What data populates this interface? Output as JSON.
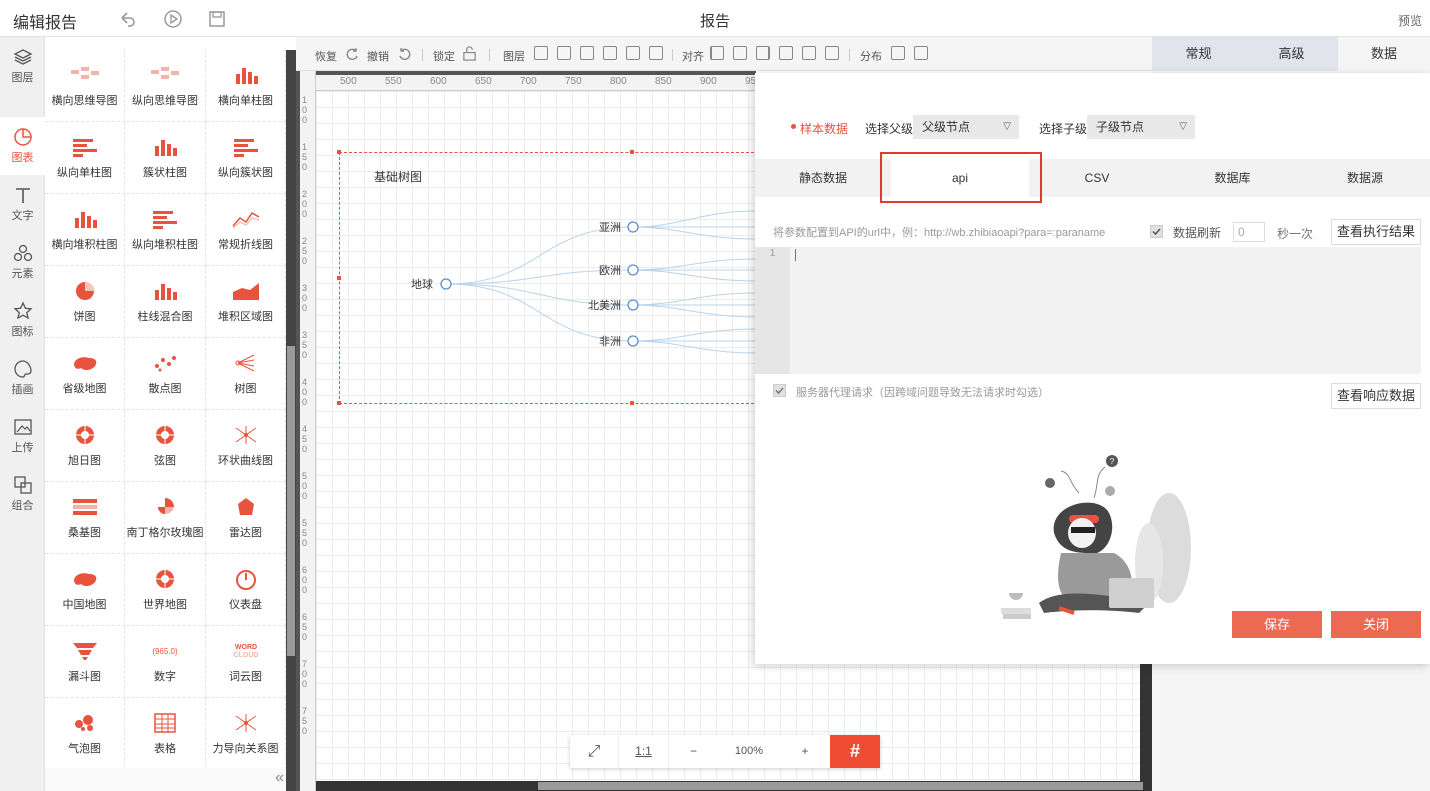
{
  "topbar": {
    "title": "编辑报告",
    "center_title": "报告",
    "preview": "预览"
  },
  "leftnav": [
    {
      "label": "图层",
      "icon": "layers-icon"
    },
    {
      "label": "图表",
      "icon": "chart-icon"
    },
    {
      "label": "文字",
      "icon": "text-icon"
    },
    {
      "label": "元素",
      "icon": "elements-icon"
    },
    {
      "label": "图标",
      "icon": "star-icon"
    },
    {
      "label": "插画",
      "icon": "palette-icon"
    },
    {
      "label": "上传",
      "icon": "upload-icon"
    },
    {
      "label": "组合",
      "icon": "group-icon"
    }
  ],
  "palette": [
    "横向思维导图",
    "纵向思维导图",
    "横向单柱图",
    "纵向单柱图",
    "簇状柱图",
    "纵向簇状图",
    "横向堆积柱图",
    "纵向堆积柱图",
    "常规折线图",
    "饼图",
    "柱线混合图",
    "堆积区域图",
    "省级地图",
    "散点图",
    "树图",
    "旭日图",
    "弦图",
    "环状曲线图",
    "桑基图",
    "南丁格尔玫瑰图",
    "雷达图",
    "中国地图",
    "世界地图",
    "仪表盘",
    "漏斗图",
    "数字",
    "词云图",
    "气泡图",
    "表格",
    "力导向关系图"
  ],
  "palette_extra": {
    "number_icon_text": "965.0",
    "wordcloud_line1": "WORD",
    "wordcloud_line2": "CLOUD"
  },
  "toolbar": {
    "redo": "恢复",
    "undo": "撤销",
    "lock": "锁定",
    "layer": "图层",
    "align": "对齐",
    "distribute": "分布"
  },
  "ruler_ticks": [
    "500",
    "550",
    "600",
    "650",
    "700",
    "750",
    "800",
    "850",
    "900",
    "95"
  ],
  "vruler_ticks": [
    "100",
    "150",
    "200",
    "250",
    "300",
    "350",
    "400",
    "450",
    "500",
    "550",
    "600",
    "650",
    "700",
    "750"
  ],
  "chart": {
    "title": "基础树图",
    "root": "地球",
    "children": [
      "亚洲",
      "欧洲",
      "北美洲",
      "非洲"
    ]
  },
  "zoom": {
    "fit": "⤢",
    "one_to_one": "1:1",
    "minus": "−",
    "level": "100%",
    "plus": "+",
    "grid": "#"
  },
  "right_tabs": [
    "常规",
    "高级",
    "数据"
  ],
  "dialog": {
    "sample_data": "样本数据",
    "parent_label": "选择父级",
    "parent_value": "父级节点",
    "child_label": "选择子级",
    "child_value": "子级节点",
    "tabs": [
      "静态数据",
      "api",
      "CSV",
      "数据库",
      "数据源"
    ],
    "active_tab": "api",
    "api_hint": "将参数配置到API的url中，例：http://wb.zhibiaoapi?para=:paraname",
    "refresh_label": "数据刷新",
    "refresh_value": "0",
    "refresh_unit": "秒一次",
    "view_result": "查看执行结果",
    "line_number": "1",
    "proxy_label": "服务器代理请求（因跨域问题导致无法请求时勾选）",
    "view_response": "查看响应数据",
    "save": "保存",
    "close": "关闭"
  },
  "colors": {
    "accent": "#e8533e",
    "button_red": "#ec6a52",
    "highlight_box": "#e23b2b"
  }
}
